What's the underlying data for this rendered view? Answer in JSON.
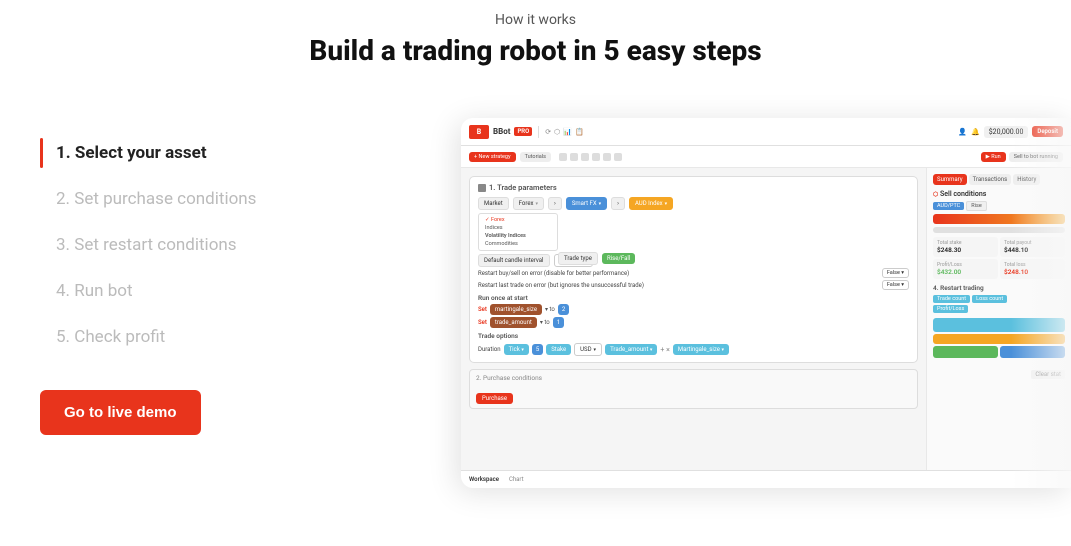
{
  "header": {
    "how_it_works": "How it works",
    "main_heading": "Build a trading robot in 5 easy steps"
  },
  "steps": [
    {
      "id": 1,
      "label": "1. Select your asset",
      "active": true
    },
    {
      "id": 2,
      "label": "2. Set purchase conditions",
      "active": false
    },
    {
      "id": 3,
      "label": "3. Set restart conditions",
      "active": false
    },
    {
      "id": 4,
      "label": "4. Run bot",
      "active": false
    },
    {
      "id": 5,
      "label": "5. Check profit",
      "active": false
    }
  ],
  "cta": {
    "label": "Go to live demo"
  },
  "mockup": {
    "topbar": {
      "logo": "B",
      "appname": "BBot",
      "tag": "PRO",
      "balance": "$20,000.00",
      "deposit": "Deposit"
    },
    "blocks": {
      "trade_params": "1. Trade parameters",
      "purchase_conds": "2. Purchase conditions"
    },
    "sidebar": {
      "tabs": [
        "Summary",
        "Transactions",
        "History"
      ],
      "sell_conditions": "Sell conditions",
      "restart_trading": "4. Restart trading"
    },
    "footer": {
      "tabs": [
        "Workspace",
        "Chart"
      ]
    }
  }
}
